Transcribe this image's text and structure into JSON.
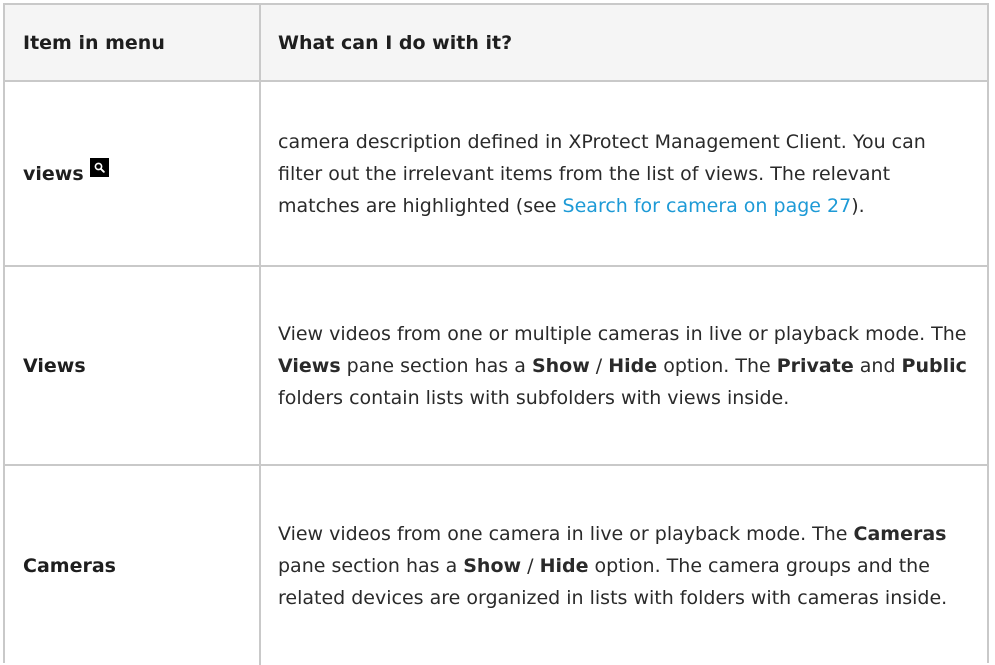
{
  "table": {
    "headers": {
      "item": "Item in menu",
      "what": "What can I do with it?"
    },
    "rows": [
      {
        "item": "views",
        "icon": "search-icon",
        "text_before_link": "camera description defined in XProtect Management Client. You can filter out the irrelevant items from the list of views. The relevant matches are highlighted (see ",
        "link_text": "Search for camera on page 27",
        "text_after_link": ")."
      },
      {
        "item": "Views",
        "t1": "View videos from one or multiple cameras in live or playback mode. The ",
        "b1": "Views",
        "t2": " pane section has a ",
        "b2": "Show",
        "t3": " / ",
        "b3": "Hide",
        "t4": " option. The ",
        "b4": "Private",
        "t5": " and ",
        "b5": "Public",
        "t6": " folders contain lists with subfolders with views inside."
      },
      {
        "item": "Cameras",
        "t1": "View videos from one camera in live or playback mode. The ",
        "b1": "Cameras",
        "t2": " pane section has a ",
        "b2": "Show",
        "t3": " / ",
        "b3": "Hide",
        "t4": " option. The camera groups and the related devices are organized in lists with folders with cameras inside."
      }
    ]
  },
  "colors": {
    "link": "#1d9ad6",
    "border": "#c9c9c9",
    "header_bg": "#f5f5f5",
    "text": "#2a2a2a"
  }
}
